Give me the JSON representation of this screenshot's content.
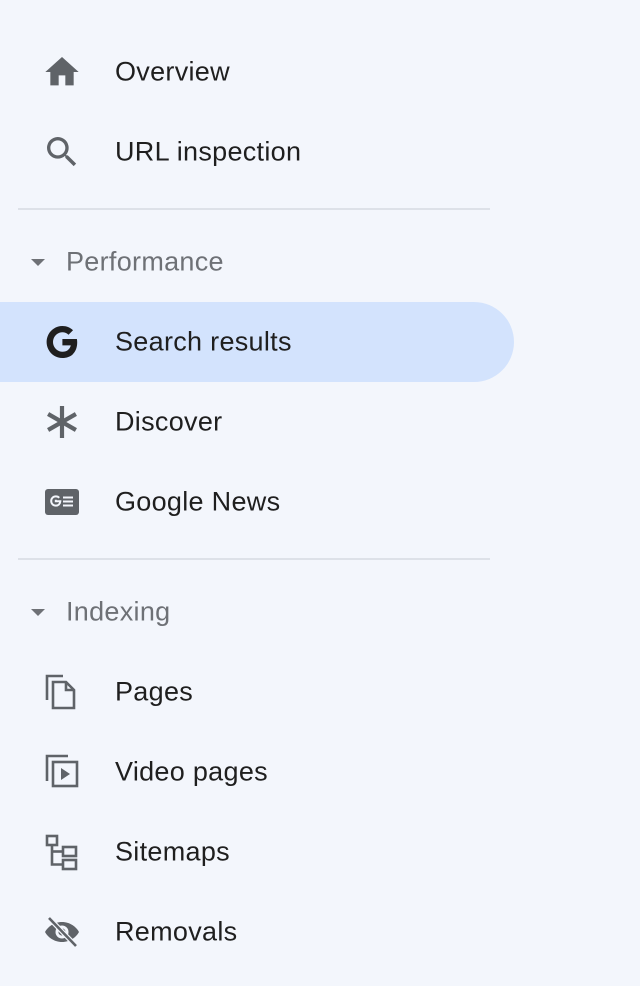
{
  "nav": {
    "top_items": [
      {
        "label": "Overview",
        "icon": "home-icon"
      },
      {
        "label": "URL inspection",
        "icon": "search-icon"
      }
    ],
    "performance": {
      "label": "Performance",
      "items": [
        {
          "label": "Search results",
          "icon": "google-g-icon",
          "active": true
        },
        {
          "label": "Discover",
          "icon": "asterisk-icon"
        },
        {
          "label": "Google News",
          "icon": "google-news-icon"
        }
      ]
    },
    "indexing": {
      "label": "Indexing",
      "items": [
        {
          "label": "Pages",
          "icon": "pages-icon"
        },
        {
          "label": "Video pages",
          "icon": "video-pages-icon"
        },
        {
          "label": "Sitemaps",
          "icon": "sitemap-icon"
        },
        {
          "label": "Removals",
          "icon": "eye-off-icon"
        }
      ]
    }
  },
  "colors": {
    "background": "#f3f6fc",
    "active_bg": "#d3e3fd",
    "icon": "#5f6368",
    "section_label": "#6e7176",
    "text": "#1f1f1f"
  }
}
